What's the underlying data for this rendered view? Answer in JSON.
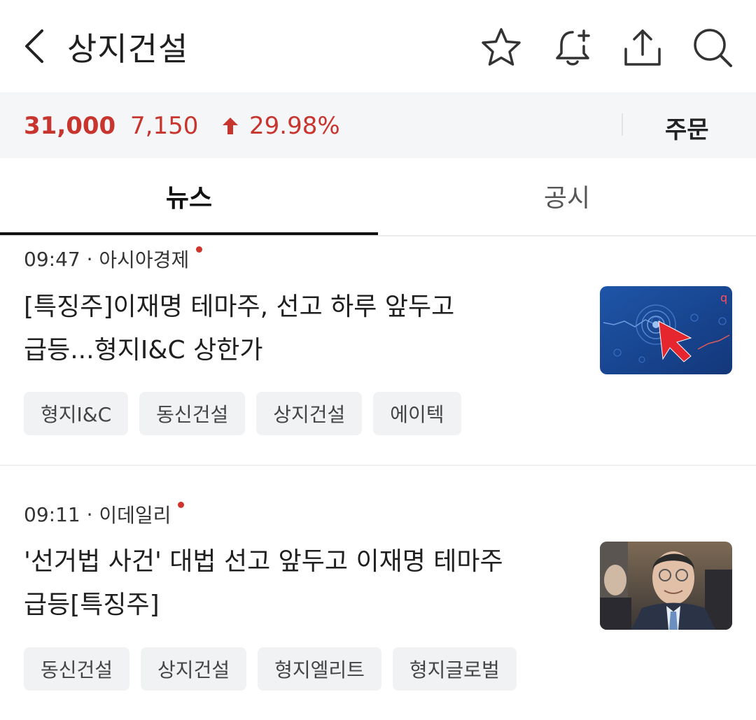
{
  "header": {
    "title": "상지건설",
    "icons": [
      "back-arrow-icon",
      "star-icon",
      "bell-plus-icon",
      "share-icon",
      "search-icon"
    ]
  },
  "price_bar": {
    "price": "31,000",
    "change": "7,150",
    "rate": "29.98%",
    "direction": "up",
    "order_label": "주문",
    "color_up": "#c8352e"
  },
  "tabs": [
    {
      "label": "뉴스",
      "active": true
    },
    {
      "label": "공시",
      "active": false
    }
  ],
  "news": [
    {
      "time": "09:47",
      "source": "아시아경제",
      "unread": true,
      "title_line1": "[특징주]이재명 테마주, 선고 하루 앞두고",
      "title_line2": "급등...형지I&C 상한가",
      "thumbnail": "stock-chart-cursor-image",
      "tags": [
        "형지I&C",
        "동신건설",
        "상지건설",
        "에이텍"
      ]
    },
    {
      "time": "09:11",
      "source": "이데일리",
      "unread": true,
      "title_line1": "'선거법 사건' 대법 선고 앞두고 이재명 테마주",
      "title_line2": "급등[특징주]",
      "thumbnail": "politician-photo-image",
      "tags": [
        "동신건설",
        "상지건설",
        "형지엘리트",
        "형지글로벌"
      ]
    }
  ]
}
